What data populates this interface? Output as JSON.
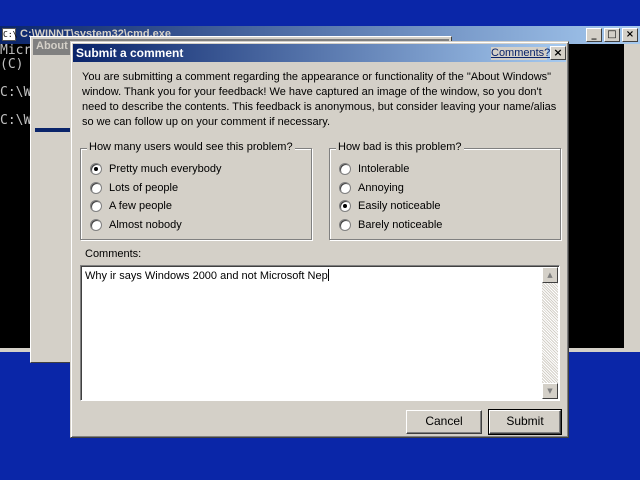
{
  "console": {
    "title": "C:\\WINNT\\system32\\cmd.exe",
    "icon_label": "C:\\",
    "lines": [
      "Micr",
      "(C)",
      "",
      "C:\\W",
      "",
      "C:\\W"
    ],
    "buttons": {
      "minimize": "_",
      "maximize": "□",
      "close": "×"
    }
  },
  "about_window": {
    "title": "About"
  },
  "dialog": {
    "title": "Submit a comment",
    "comments_link": "Comments?",
    "close_label": "×",
    "intro": "You are submitting a comment regarding the appearance or functionality of the \"About Windows\" window. Thank you for your feedback! We have captured an image of the window, so you don't need to describe the contents. This feedback is anonymous, but consider leaving your name/alias so we can follow up on your comment if necessary."
  },
  "users_group": {
    "legend": "How many users would see this problem?",
    "options": [
      {
        "label": "Pretty much everybody",
        "selected": true
      },
      {
        "label": "Lots of people",
        "selected": false
      },
      {
        "label": "A few people",
        "selected": false
      },
      {
        "label": "Almost nobody",
        "selected": false
      }
    ]
  },
  "severity_group": {
    "legend": "How bad is this problem?",
    "options": [
      {
        "label": "Intolerable",
        "selected": false
      },
      {
        "label": "Annoying",
        "selected": false
      },
      {
        "label": "Easily noticeable",
        "selected": true
      },
      {
        "label": "Barely noticeable",
        "selected": false
      }
    ]
  },
  "comments": {
    "label": "Comments:",
    "value": "Why ir says Windows 2000 and not Microsoft Nep"
  },
  "buttons": {
    "cancel": "Cancel",
    "submit": "Submit"
  },
  "colors": {
    "desktop": "#0a26a8",
    "titlebar_active": "#0a246a",
    "face": "#d4d0c8"
  }
}
